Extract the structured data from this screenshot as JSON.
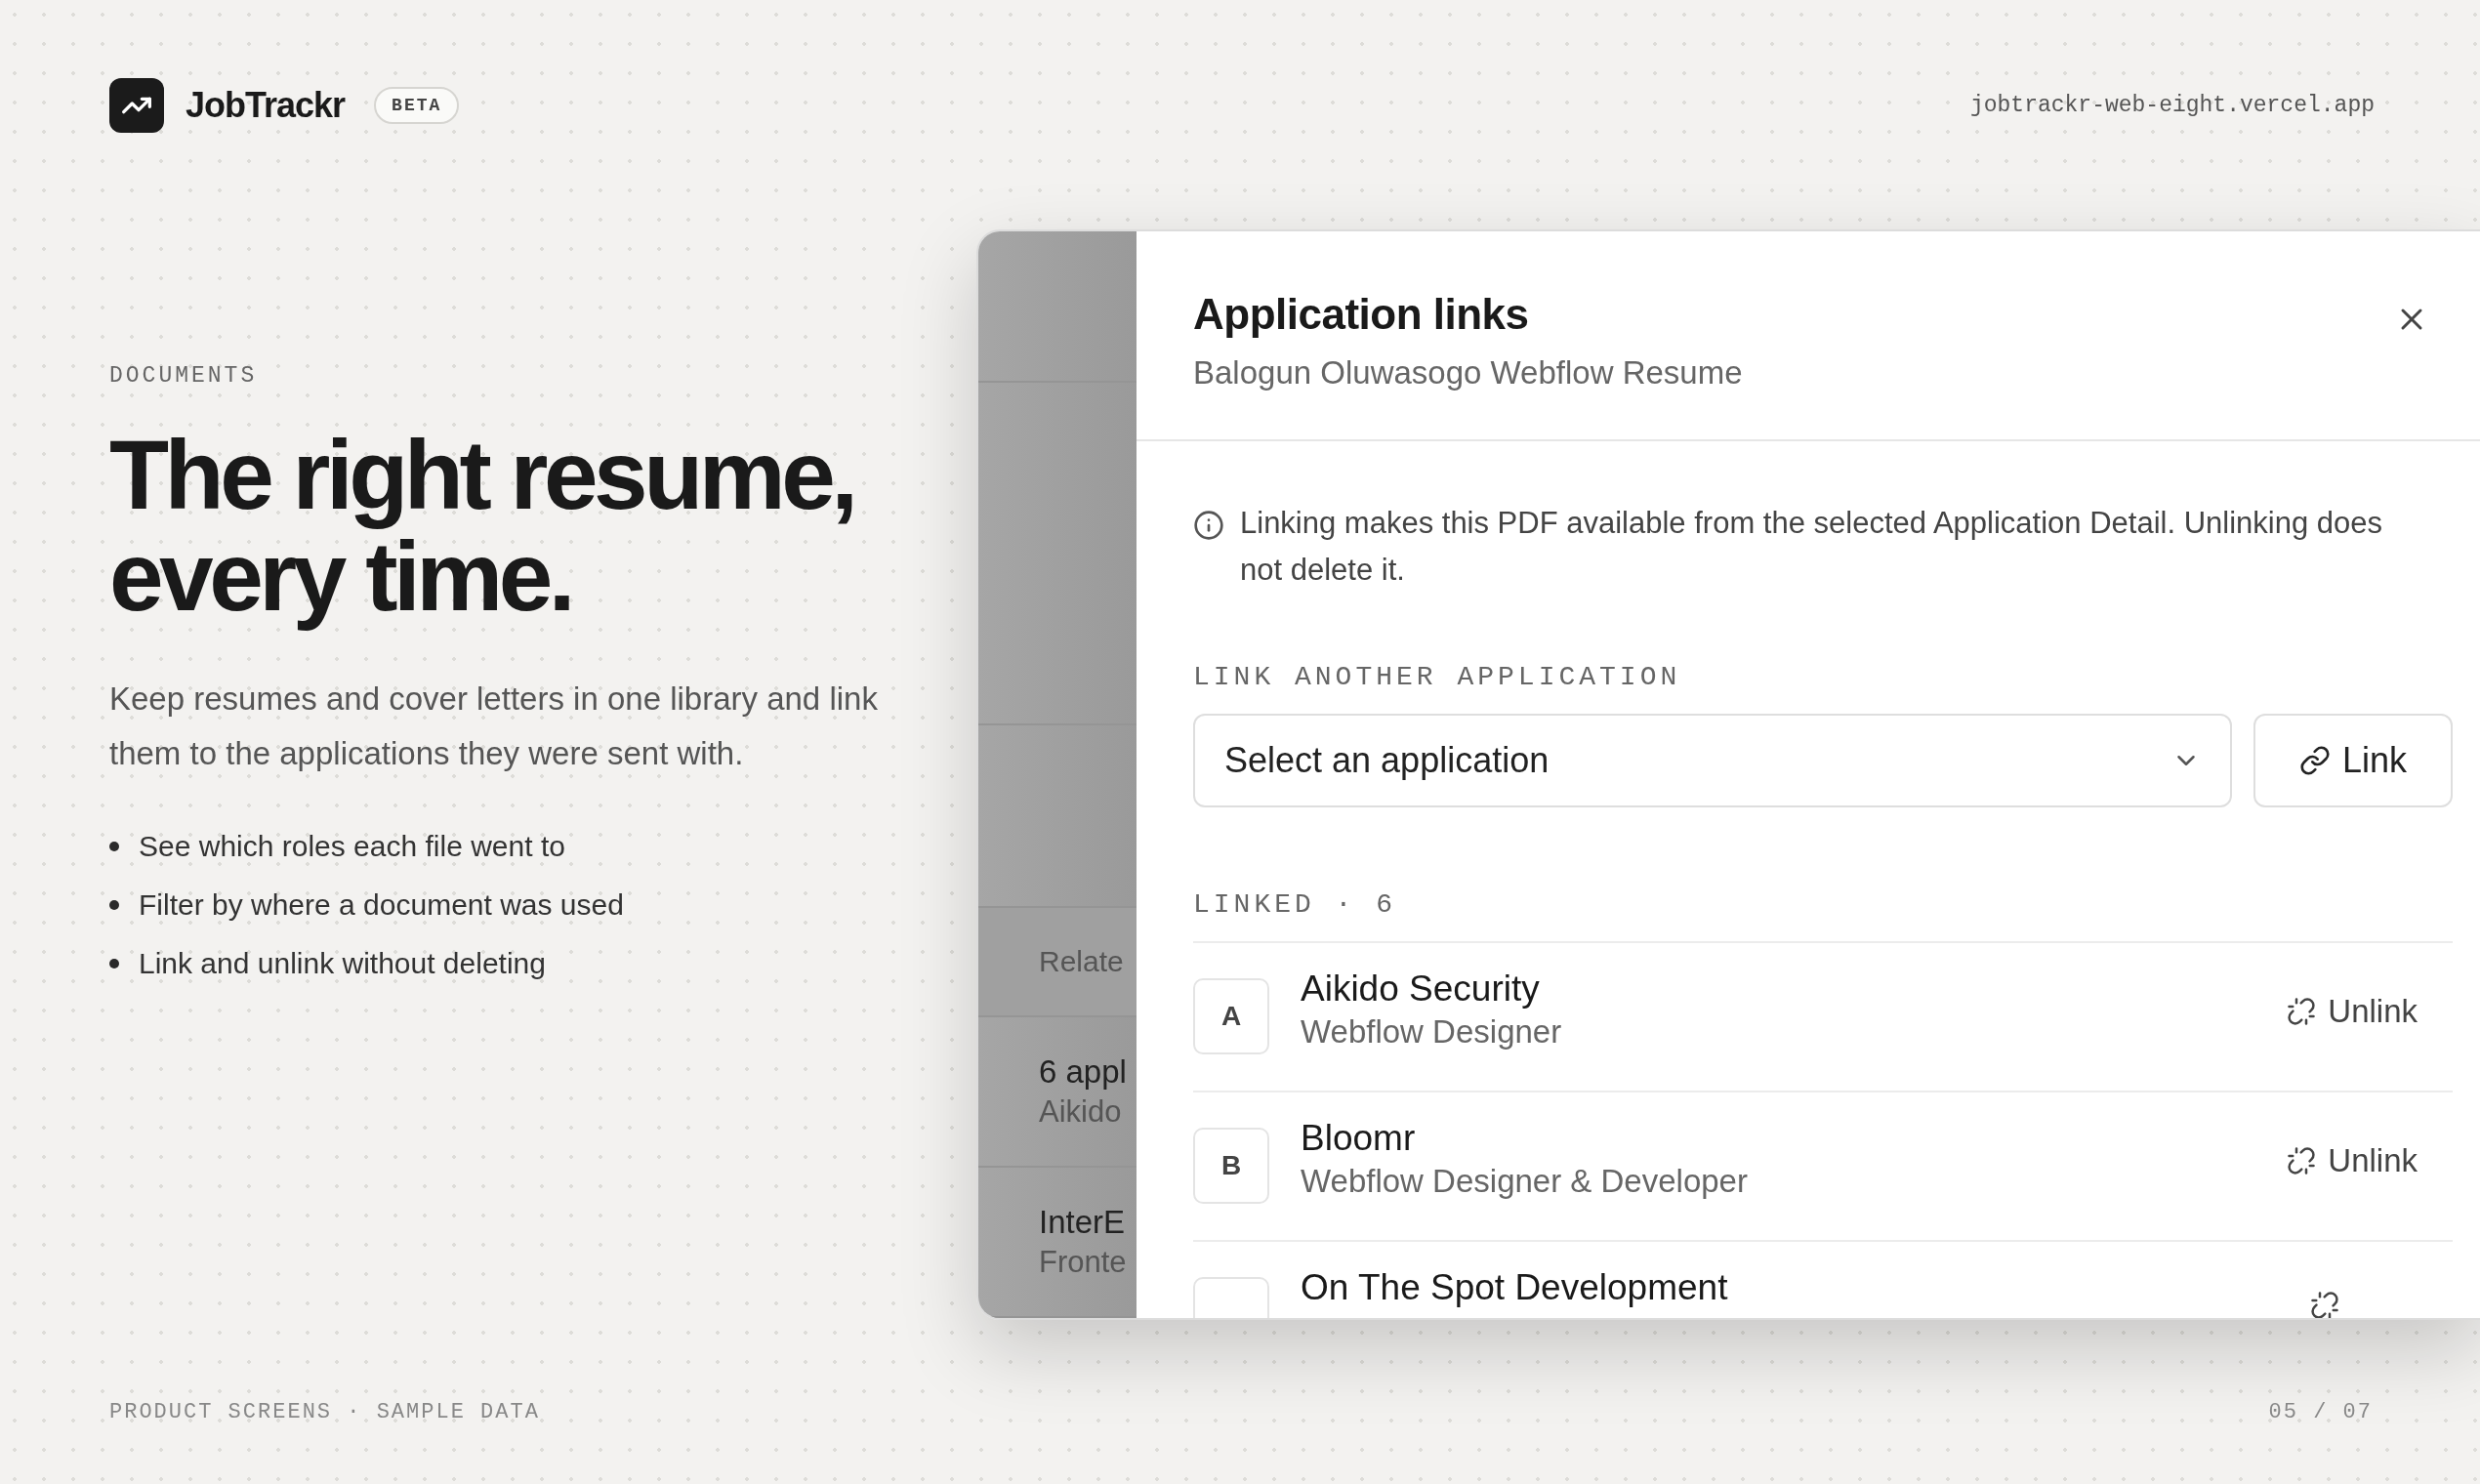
{
  "brand": {
    "name": "JobTrackr",
    "badge": "BETA"
  },
  "url": "jobtrackr-web-eight.vercel.app",
  "hero": {
    "eyebrow": "DOCUMENTS",
    "headline_lines": [
      "The right resume,",
      "every time."
    ],
    "intro": "Keep resumes and cover letters in one library and link them to the applications they were sent with.",
    "bullets": [
      "See which roles each file went to",
      "Filter by where a document was used",
      "Link and unlink without deleting"
    ]
  },
  "background_app": {
    "section_label": "Relate",
    "rows": [
      {
        "title": "6 appl",
        "subtitle": "Aikido"
      },
      {
        "title": "InterE",
        "subtitle": "Fronte"
      }
    ]
  },
  "drawer": {
    "title": "Application links",
    "subtitle": "Balogun Oluwasogo Webflow Resume",
    "info": "Linking makes this PDF available from the selected Application Detail. Unlinking does not delete it.",
    "link_label": "LINK ANOTHER APPLICATION",
    "select": {
      "placeholder": "Select an application"
    },
    "link_button": "Link",
    "linked_label": "LINKED · 6",
    "linked": [
      {
        "initial": "A",
        "company": "Aikido Security",
        "role": "Webflow Designer",
        "action": "Unlink"
      },
      {
        "initial": "B",
        "company": "Bloomr",
        "role": "Webflow Designer & Developer",
        "action": "Unlink"
      },
      {
        "company": "On The Spot Development"
      }
    ]
  },
  "footer": {
    "caption": "PRODUCT SCREENS · SAMPLE DATA",
    "page": "05 / 07"
  }
}
